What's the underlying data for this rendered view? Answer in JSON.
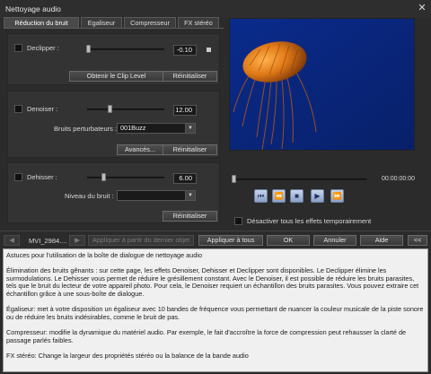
{
  "window": {
    "title": "Nettoyage audio",
    "close_label": "✕"
  },
  "tabs": [
    {
      "label": "Réduction du bruit",
      "active": true
    },
    {
      "label": "Egaliseur",
      "active": false
    },
    {
      "label": "Compresseur",
      "active": false
    },
    {
      "label": "FX stéréo",
      "active": false
    }
  ],
  "declipper": {
    "label": "Declipper :",
    "value": "-0.10",
    "obtain_label": "Obtenir le Clip Level",
    "reset_label": "Réinitialiser"
  },
  "denoiser": {
    "label": "Denoiser :",
    "value": "12.00",
    "noise_label": "Bruits perturbateurs :",
    "noise_value": "001Buzz",
    "advanced_label": "Avancés...",
    "reset_label": "Réinitialiser"
  },
  "dehisser": {
    "label": "Dehisser :",
    "value": "6.00",
    "level_label": "Niveau du bruit :",
    "level_value": "",
    "reset_label": "Réinitialiser"
  },
  "player": {
    "timecode": "00:00:00:00",
    "disable_label": "Désactiver tous les effets temporairement"
  },
  "bottom_bar": {
    "object_name": "MVI_2984....",
    "apply_from_label": "Appliquer à partir du dernier objet",
    "apply_all_label": "Appliquer à tous",
    "ok_label": "OK",
    "cancel_label": "Annuler",
    "help_label": "Aide",
    "collapse_label": "<<"
  },
  "help_text": [
    "Astuces pour l'utilisation de la boîte de dialogue de nettoyage audio",
    "Élimination des bruits gênants : sur cette page, les effets Denoiser, Dehisser et Declipper sont disponibles. Le Declipper élimine les surmodulations. Le Dehisser vous permet de réduire le grésillement constant. Avec le Denoiser, il est possible de réduire les bruits parasites, tels que le bruit du lecteur de votre appareil photo. Pour cela, le Denoiser requiert un échantillon des bruits parasites. Vous pouvez extraire cet échantillon grâce à une sous-boîte de dialogue.",
    "Égaliseur: met à votre disposition un égaliseur avec 10 bandes de fréquence vous permettant de nuancer la couleur musicale de la piste sonore ou de réduire les bruits indésirables, comme le bruit de pas.",
    "Compresseur: modifie la dynamique du matériel audio. Par exemple, le fait d'accroître la force de compression peut rehausser la clarté de passage parlés faibles.",
    "FX stéréo: Change la largeur des propriétés stéréo ou la balance de la bande audio"
  ],
  "colors": {
    "accent_video": "#0b2a86",
    "jellyfish": "#e07a18",
    "transport": "#a9bade"
  }
}
